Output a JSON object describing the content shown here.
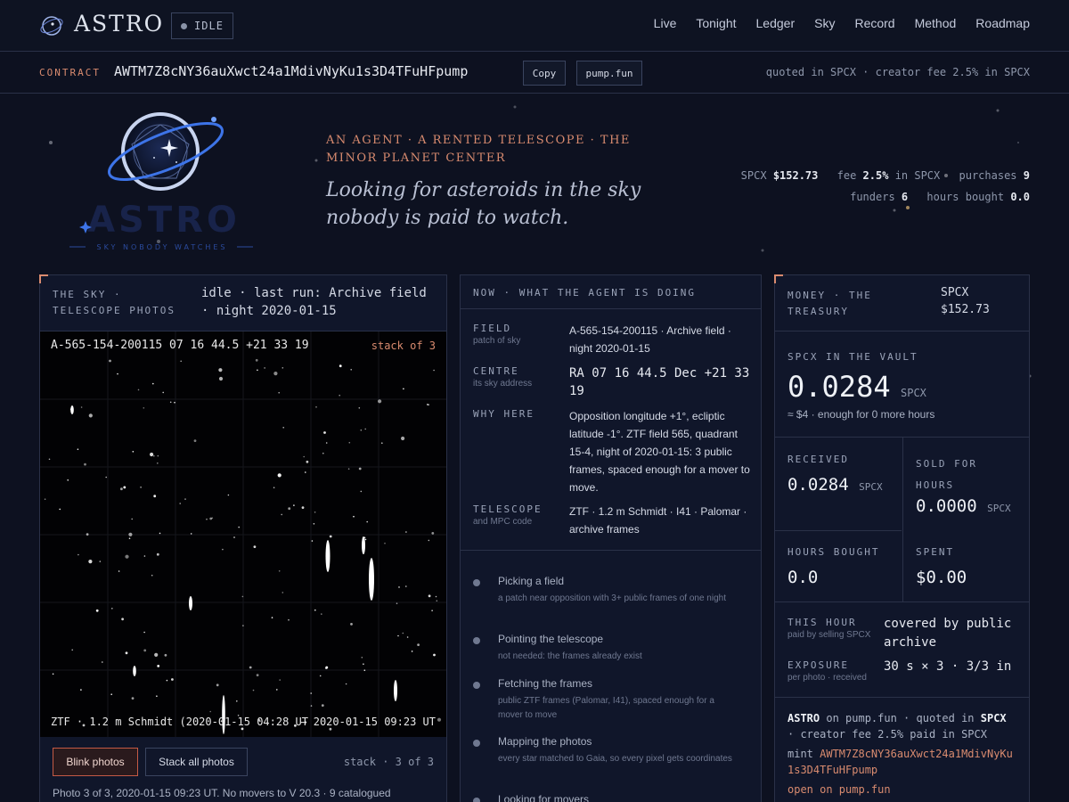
{
  "nav": {
    "brand": "ASTRO",
    "status": "IDLE",
    "links": [
      "Live",
      "Tonight",
      "Ledger",
      "Sky",
      "Record",
      "Method",
      "Roadmap"
    ]
  },
  "contract": {
    "label": "CONTRACT",
    "address": "AWTM7Z8cNY36auXwct24a1MdivNyKu1s3D4TFuHFpump",
    "copy_label": "Copy",
    "pump_label": "pump.fun",
    "note": "quoted in SPCX · creator fee 2.5% in SPCX"
  },
  "hero": {
    "logo_text": "ASTRO",
    "logo_tagline": "SKY NOBODY WATCHES",
    "kicker": "AN AGENT · A RENTED TELESCOPE · THE MINOR PLANET CENTER",
    "title": "Looking for asteroids in the sky nobody is paid to watch.",
    "stats": {
      "spcx_label": "SPCX",
      "spcx_value": "$152.73",
      "fee_label": "fee",
      "fee_value": "2.5%",
      "fee_suffix": "in SPCX",
      "purchases_label": "purchases",
      "purchases_value": "9",
      "funders_label": "funders",
      "funders_value": "6",
      "hours_label": "hours bought",
      "hours_value": "0.0"
    }
  },
  "sky": {
    "caption": "THE SKY · TELESCOPE PHOTOS",
    "status": "idle · last run: Archive field · night 2020-01-15",
    "coord": "A-565-154-200115 07 16 44.5 +21 33 19",
    "stack": "stack of 3",
    "foot": "ZTF · 1.2 m Schmidt (2020-01-15 04:28 UT",
    "range": "→ 2020-01-15 09:23 UT",
    "blink_label": "Blink photos",
    "stack_all_label": "Stack all photos",
    "stack_count": "stack · 3 of 3",
    "photo_caption": "Photo 3 of 3, 2020-01-15 09:23 UT. No movers to V 20.3 · 9 catalogued"
  },
  "agent": {
    "caption": "NOW · WHAT THE AGENT IS DOING",
    "field": {
      "label": "FIELD",
      "sub": "patch of sky",
      "value": "A-565-154-200115 · Archive field · night 2020-01-15"
    },
    "centre": {
      "label": "CENTRE",
      "sub": "its sky address",
      "value": "RA 07 16 44.5 Dec +21 33 19"
    },
    "why": {
      "label": "WHY HERE",
      "value": "Opposition longitude +1°, ecliptic latitude -1°. ZTF field 565, quadrant 15-4, night of 2020-01-15: 3 public frames, spaced enough for a mover to move."
    },
    "telescope": {
      "label": "TELESCOPE",
      "sub": "and MPC code",
      "value": "ZTF · 1.2 m Schmidt · I41 · Palomar · archive frames"
    },
    "steps": [
      {
        "title": "Picking a field",
        "desc": "a patch near opposition with 3+ public frames of one night"
      },
      {
        "title": "Pointing the telescope",
        "desc": "not needed: the frames already exist"
      },
      {
        "title": "Fetching the frames",
        "desc": "public ZTF frames (Palomar, I41), spaced enough for a mover to move"
      },
      {
        "title": "Mapping the photos",
        "desc": "every star matched to Gaia, so every pixel gets coordinates"
      },
      {
        "title": "Looking for movers",
        "desc": ""
      }
    ]
  },
  "money": {
    "caption": "MONEY · THE TREASURY",
    "head_value": "SPCX $152.73",
    "vault_caption": "SPCX IN THE VAULT",
    "vault_value": "0.0284",
    "vault_unit": "SPCX",
    "vault_note": "≈ $4 · enough for 0 more hours",
    "received_label": "RECEIVED",
    "received_value": "0.0284",
    "received_unit": "SPCX",
    "sold_label": "SOLD FOR HOURS",
    "sold_value": "0.0000",
    "sold_unit": "SPCX",
    "hours_label": "HOURS BOUGHT",
    "hours_value": "0.0",
    "spent_label": "SPENT",
    "spent_value": "$0.00",
    "this_hour_label": "THIS HOUR",
    "this_hour_sub": "paid by selling SPCX",
    "this_hour_value": "covered by public archive",
    "exposure_label": "EXPOSURE",
    "exposure_sub": "per photo · received",
    "exposure_value": "30 s × 3 · 3/3 in",
    "pump_line1_a": "ASTRO",
    "pump_line1_b": " on pump.fun · quoted in ",
    "pump_line1_c": "SPCX",
    "pump_line1_d": " · creator fee 2.5% paid in SPCX",
    "pump_mint_label": "mint ",
    "pump_mint": "AWTM7Z8cNY36auXwct24a1MdivNyKu1s3D4TFuHFpump",
    "pump_open": "open on pump.fun"
  },
  "colors": {
    "accent": "#d98b6f",
    "bg": "#0d1120",
    "panel": "#10162a",
    "border": "#2a3148"
  }
}
